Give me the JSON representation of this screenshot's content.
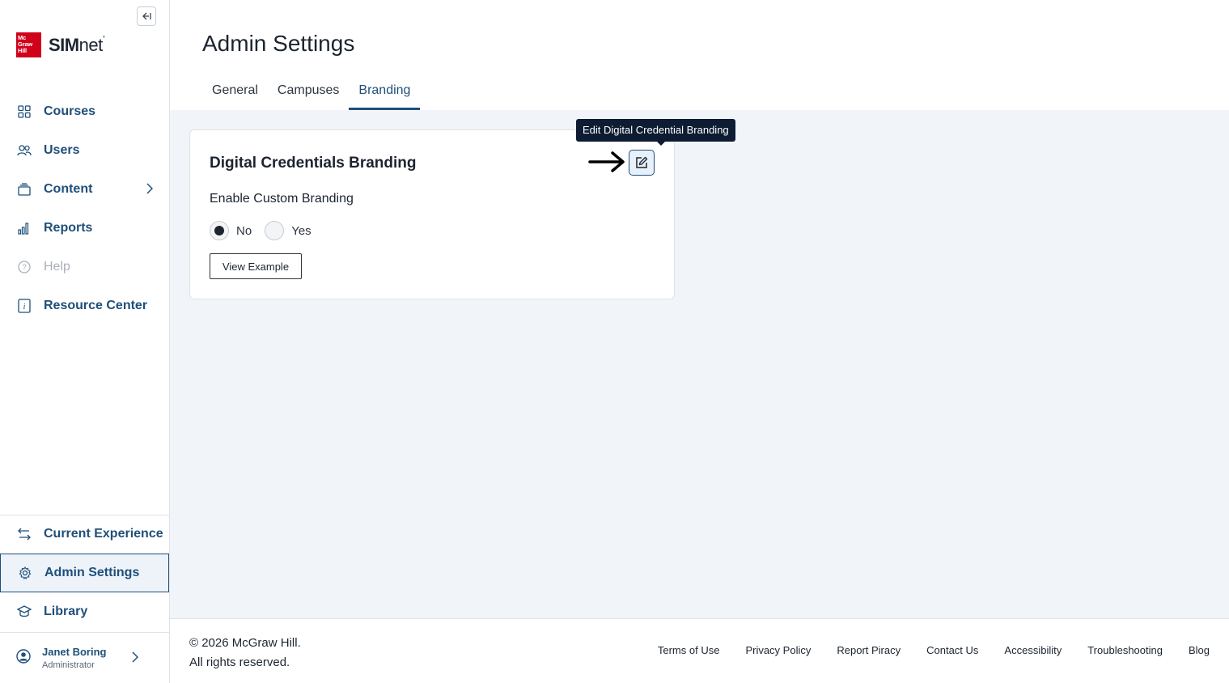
{
  "sidebar": {
    "logo": {
      "box_text": "Mc Graw Hill",
      "brand_bold": "SIM",
      "brand_light": "net",
      "tm": "°"
    },
    "items": [
      {
        "label": "Courses"
      },
      {
        "label": "Users"
      },
      {
        "label": "Content"
      },
      {
        "label": "Reports"
      },
      {
        "label": "Help"
      },
      {
        "label": "Resource Center"
      }
    ],
    "bottom_items": [
      {
        "label": "Current Experience"
      },
      {
        "label": "Admin Settings"
      },
      {
        "label": "Library"
      }
    ],
    "user": {
      "name": "Janet Boring",
      "role": "Administrator"
    }
  },
  "header": {
    "title": "Admin Settings",
    "tabs": [
      {
        "label": "General"
      },
      {
        "label": "Campuses"
      },
      {
        "label": "Branding"
      }
    ]
  },
  "card": {
    "title": "Digital Credentials Branding",
    "tooltip": "Edit Digital Credential Branding",
    "section_label": "Enable Custom Branding",
    "options": [
      {
        "label": "No",
        "checked": true
      },
      {
        "label": "Yes",
        "checked": false
      }
    ],
    "view_button": "View Example"
  },
  "footer": {
    "copyright_line1": "© 2026 McGraw Hill.",
    "copyright_line2": "All rights reserved.",
    "links": [
      "Terms of Use",
      "Privacy Policy",
      "Report Piracy",
      "Contact Us",
      "Accessibility",
      "Troubleshooting",
      "Blog"
    ]
  },
  "colors": {
    "accent": "#1f4f79",
    "brand_red": "#d0021b",
    "content_bg": "#f1f4f8",
    "tooltip_bg": "#0d1b33"
  }
}
